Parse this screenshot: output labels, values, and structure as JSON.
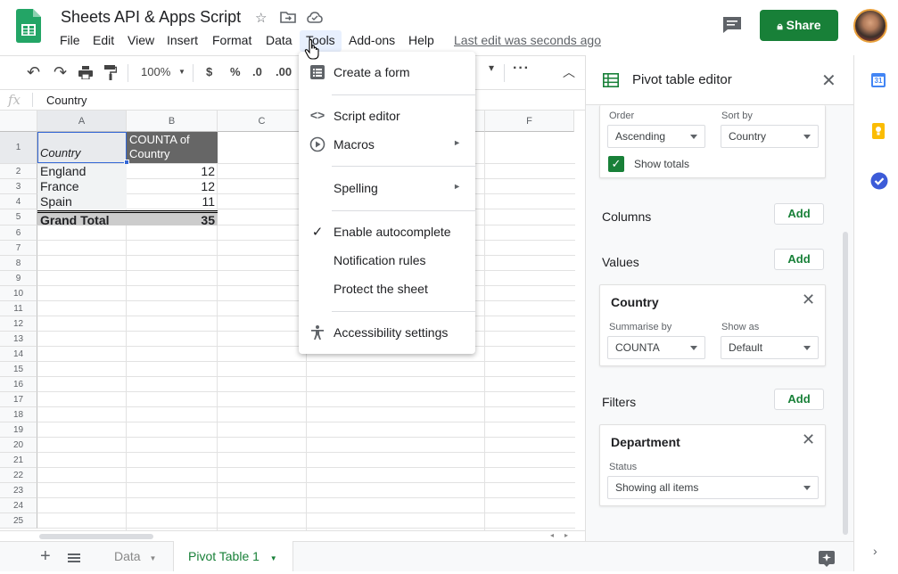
{
  "app": {
    "title": "Sheets API & Apps Script",
    "last_edit": "Last edit was seconds ago",
    "share_label": "Share",
    "accent": "#188038"
  },
  "menubar": [
    "File",
    "Edit",
    "View",
    "Insert",
    "Format",
    "Data",
    "Tools",
    "Add-ons",
    "Help"
  ],
  "toolbar": {
    "zoom": "100%",
    "currency": "$",
    "percent": "%",
    "decrease_decimal": ".0",
    "increase_decimal": ".00"
  },
  "formula_bar": {
    "fx": "fx",
    "value": "Country"
  },
  "grid": {
    "columns": [
      "A",
      "B",
      "C",
      "D",
      "E",
      "F"
    ],
    "rows": [
      "1",
      "2",
      "3",
      "4",
      "5",
      "6",
      "7",
      "8",
      "9",
      "10",
      "11",
      "12",
      "13",
      "14",
      "15",
      "16",
      "17",
      "18",
      "19",
      "20",
      "21",
      "22",
      "23",
      "24",
      "25"
    ],
    "cells": {
      "a1": "Country",
      "b1": "COUNTA of Country",
      "a2": "England",
      "b2": "12",
      "a3": "France",
      "b3": "12",
      "a4": "Spain",
      "b4": "11",
      "a5": "Grand Total",
      "b5": "35"
    }
  },
  "tools_menu": {
    "create_form": "Create a form",
    "script_editor": "Script editor",
    "macros": "Macros",
    "spelling": "Spelling",
    "autocomplete": "Enable autocomplete",
    "notification_rules": "Notification rules",
    "protect_sheet": "Protect the sheet",
    "accessibility": "Accessibility settings"
  },
  "pivot": {
    "title": "Pivot table editor",
    "rows_card": {
      "order_label": "Order",
      "order_value": "Ascending",
      "sortby_label": "Sort by",
      "sortby_value": "Country",
      "show_totals": "Show totals"
    },
    "columns_label": "Columns",
    "values_label": "Values",
    "filters_label": "Filters",
    "add_label": "Add",
    "values_card": {
      "title": "Country",
      "summarise_label": "Summarise by",
      "summarise_value": "COUNTA",
      "showas_label": "Show as",
      "showas_value": "Default"
    },
    "filter_card": {
      "title": "Department",
      "status_label": "Status",
      "status_value": "Showing all items"
    }
  },
  "sheets": {
    "tabs": [
      "Data",
      "Pivot Table 1"
    ],
    "active": "Pivot Table 1"
  },
  "side_icons": [
    "calendar-icon",
    "keep-icon",
    "tasks-icon"
  ],
  "calendar_day": "31"
}
